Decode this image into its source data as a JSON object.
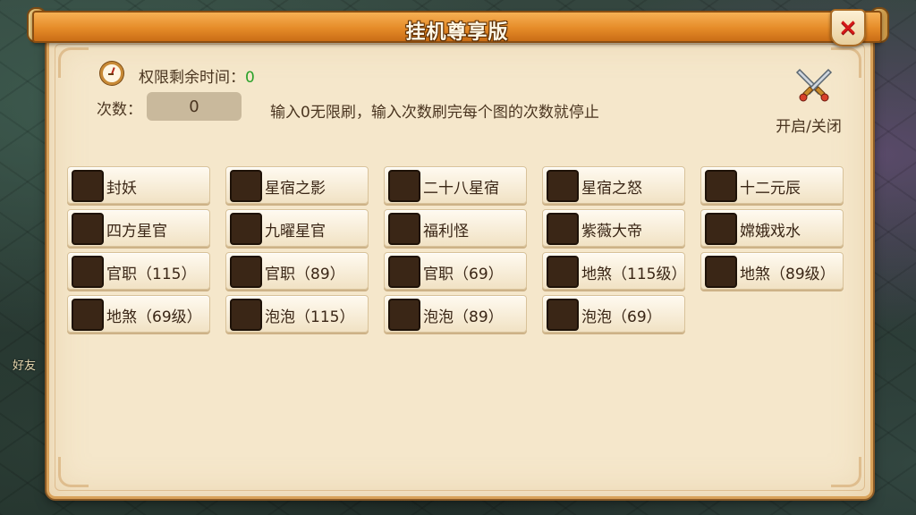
{
  "dialog": {
    "title": "挂机尊享版",
    "close_icon": "×"
  },
  "status": {
    "perm_label": "权限剩余时间：",
    "perm_value": "0"
  },
  "count": {
    "label": "次数：",
    "value": "0"
  },
  "hint": "输入0无限刷，输入次数刷完每个图的次数就停止",
  "toggle": {
    "label": "开启/关闭",
    "icon": "crossed-swords-icon"
  },
  "options": [
    {
      "label": "封妖",
      "checked": false
    },
    {
      "label": "星宿之影",
      "checked": false
    },
    {
      "label": "二十八星宿",
      "checked": false
    },
    {
      "label": "星宿之怒",
      "checked": false
    },
    {
      "label": "十二元辰",
      "checked": false
    },
    {
      "label": "四方星官",
      "checked": false
    },
    {
      "label": "九曜星官",
      "checked": false
    },
    {
      "label": "福利怪",
      "checked": false
    },
    {
      "label": "紫薇大帝",
      "checked": false
    },
    {
      "label": "嫦娥戏水",
      "checked": false
    },
    {
      "label": "官职（115）",
      "checked": false
    },
    {
      "label": "官职（89）",
      "checked": false
    },
    {
      "label": "官职（69）",
      "checked": false
    },
    {
      "label": "地煞（115级）",
      "checked": false
    },
    {
      "label": "地煞（89级）",
      "checked": false
    },
    {
      "label": "地煞（69级）",
      "checked": false
    },
    {
      "label": "泡泡（115）",
      "checked": false
    },
    {
      "label": "泡泡（89）",
      "checked": false
    },
    {
      "label": "泡泡（69）",
      "checked": false
    }
  ],
  "background": {
    "friend_label": "好友"
  },
  "colors": {
    "title_bar": "#e58b28",
    "panel": "#f5e7cb",
    "close_x": "#d41818",
    "perm_value": "#2aa12a",
    "checkbox": "#3a2616"
  }
}
